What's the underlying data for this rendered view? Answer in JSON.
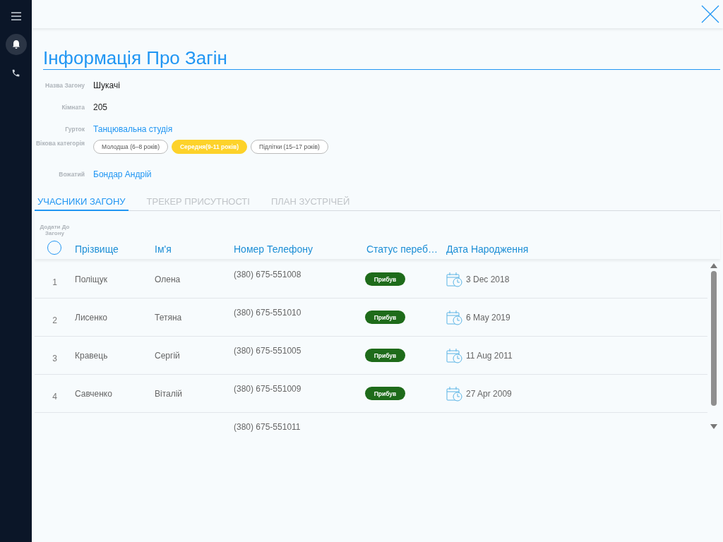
{
  "title": "Інформація Про Загін",
  "fields": [
    {
      "label": "Назва Загону",
      "value": "Шукачі",
      "kind": "text"
    },
    {
      "label": "Кімната",
      "value": "205",
      "kind": "text"
    },
    {
      "label": "Гурток",
      "value": "Танцювальна студія",
      "kind": "link"
    },
    {
      "label": "Вікова категорія",
      "kind": "chips",
      "options": [
        {
          "label": "Молодша (6–8 років)",
          "selected": false
        },
        {
          "label": "Середня(9-11 років)",
          "selected": true
        },
        {
          "label": "Підлітки (15–17 років)",
          "selected": false
        }
      ]
    },
    {
      "label": "Вожатий",
      "value": "Бондар Андрій",
      "kind": "link"
    }
  ],
  "tabs": [
    {
      "label": "УЧАСНИКИ ЗАГОНУ",
      "selected": true
    },
    {
      "label": "ТРЕКЕР ПРИСУТНОСТІ",
      "selected": false
    },
    {
      "label": "ПЛАН ЗУСТРІЧЕЙ",
      "selected": false
    }
  ],
  "table": {
    "add_label": "Додати До Загону",
    "select_all_checked": false,
    "columns": [
      "Прізвище",
      "Ім'я",
      "Номер Телефону",
      "Статус переб…",
      "Дата Народження"
    ],
    "rows": [
      {
        "number": "1",
        "surname": "Поліщук",
        "name": "Олена",
        "phone": "(380) 675-551008",
        "status": "Прибув",
        "birth_date": "3 Dec 2018"
      },
      {
        "number": "2",
        "surname": "Лисенко",
        "name": "Тетяна",
        "phone": "(380) 675-551010",
        "status": "Прибув",
        "birth_date": "6 May 2019"
      },
      {
        "number": "3",
        "surname": "Кравець",
        "name": "Сергій",
        "phone": "(380) 675-551005",
        "status": "Прибув",
        "birth_date": "11 Aug 2011"
      },
      {
        "number": "4",
        "surname": "Савченко",
        "name": "Віталій",
        "phone": "(380) 675-551009",
        "status": "Прибув",
        "birth_date": "27 Apr 2009"
      }
    ],
    "partial_row": {
      "phone": "(380) 675-551011"
    }
  }
}
